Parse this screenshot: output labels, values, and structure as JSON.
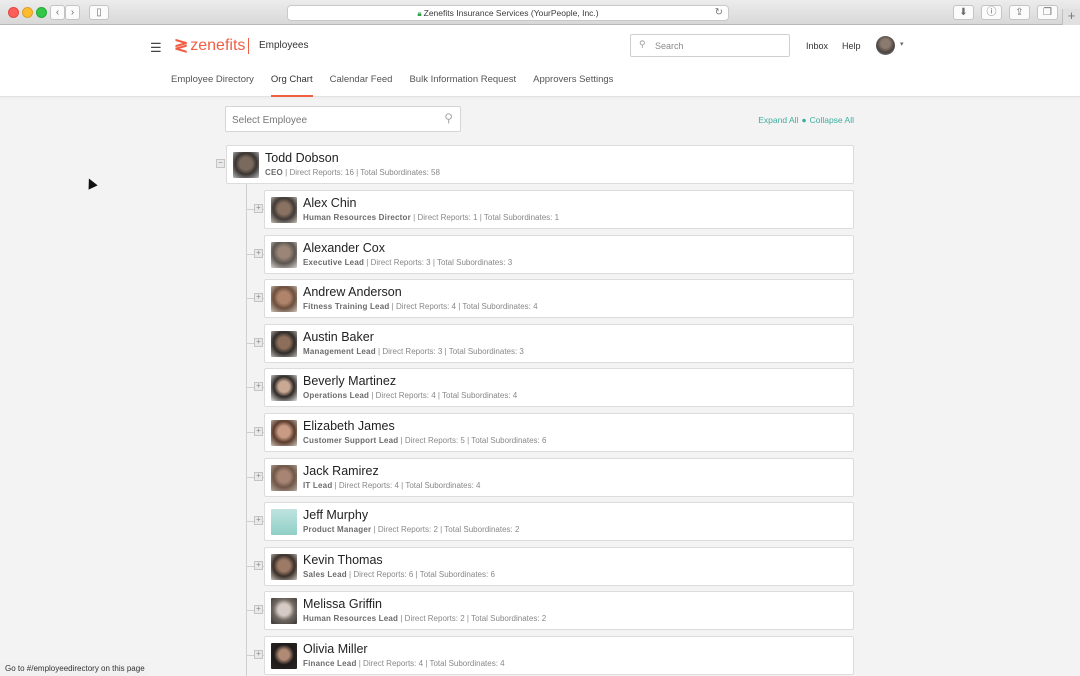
{
  "browser": {
    "address": "Zenefits Insurance Services (YourPeople, Inc.)",
    "status_text": "Go to #/employeedirectory on this page"
  },
  "header": {
    "logo_text": "zenefits",
    "section_title": "Employees",
    "search_placeholder": "Search",
    "inbox_label": "Inbox",
    "help_label": "Help"
  },
  "tabs": [
    {
      "label": "Employee Directory",
      "active": false
    },
    {
      "label": "Org Chart",
      "active": true
    },
    {
      "label": "Calendar Feed",
      "active": false
    },
    {
      "label": "Bulk Information Request",
      "active": false
    },
    {
      "label": "Approvers Settings",
      "active": false
    }
  ],
  "toolbar": {
    "select_placeholder": "Select Employee",
    "expand_all": "Expand All",
    "collapse_all": "Collapse All"
  },
  "root": {
    "name": "Todd Dobson",
    "title": "CEO",
    "stats": " | Direct Reports: 16 | Total Subordinates: 58"
  },
  "reports": [
    {
      "name": "Alex Chin",
      "title": "Human Resources Director",
      "stats": " | Direct Reports: 1 | Total Subordinates: 1"
    },
    {
      "name": "Alexander Cox",
      "title": "Executive Lead",
      "stats": " | Direct Reports: 3 | Total Subordinates: 3"
    },
    {
      "name": "Andrew Anderson",
      "title": "Fitness Training Lead",
      "stats": " | Direct Reports: 4 | Total Subordinates: 4"
    },
    {
      "name": "Austin Baker",
      "title": "Management Lead",
      "stats": " | Direct Reports: 3 | Total Subordinates: 3"
    },
    {
      "name": "Beverly Martinez",
      "title": "Operations Lead",
      "stats": " | Direct Reports: 4 | Total Subordinates: 4"
    },
    {
      "name": "Elizabeth James",
      "title": "Customer Support Lead",
      "stats": " | Direct Reports: 5 | Total Subordinates: 6"
    },
    {
      "name": "Jack Ramirez",
      "title": "IT Lead",
      "stats": " | Direct Reports: 4 | Total Subordinates: 4"
    },
    {
      "name": "Jeff Murphy",
      "title": "Product Manager",
      "stats": " | Direct Reports: 2 | Total Subordinates: 2"
    },
    {
      "name": "Kevin Thomas",
      "title": "Sales Lead",
      "stats": " | Direct Reports: 6 | Total Subordinates: 6"
    },
    {
      "name": "Melissa Griffin",
      "title": "Human Resources Lead",
      "stats": " | Direct Reports: 2 | Total Subordinates: 2"
    },
    {
      "name": "Olivia Miller",
      "title": "Finance Lead",
      "stats": " | Direct Reports: 4 | Total Subordinates: 4"
    }
  ],
  "colors": {
    "brand": "#ef5f43",
    "link": "#3fae9e"
  }
}
